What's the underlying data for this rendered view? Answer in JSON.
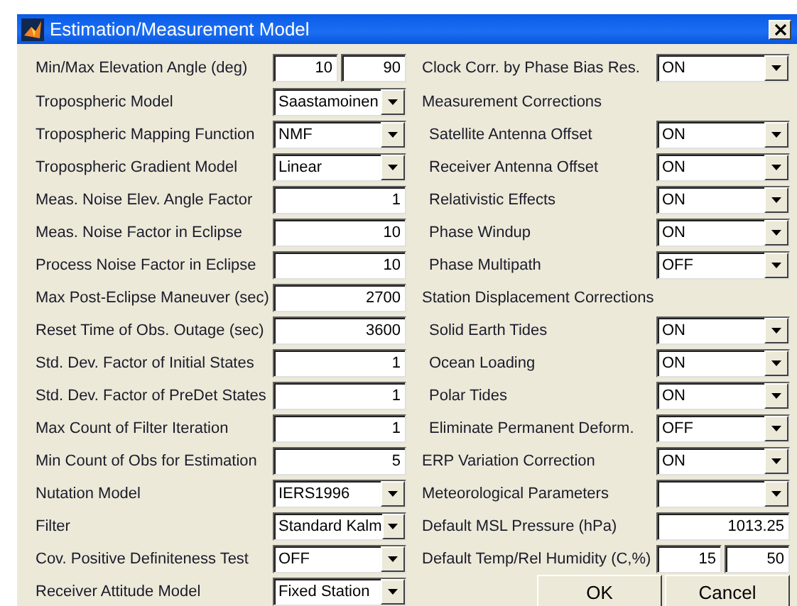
{
  "window": {
    "title": "Estimation/Measurement Model"
  },
  "left_fields": [
    {
      "kind": "edit",
      "label": "Min/Max Elevation Angle (deg)",
      "values": [
        "10",
        "90"
      ]
    },
    {
      "kind": "select",
      "label": "Tropospheric Model",
      "value": "Saastamoinen"
    },
    {
      "kind": "select",
      "label": "Tropospheric Mapping Function",
      "value": "NMF"
    },
    {
      "kind": "select",
      "label": "Tropospheric Gradient Model",
      "value": "Linear"
    },
    {
      "kind": "edit",
      "label": "Meas. Noise Elev. Angle Factor",
      "values": [
        "1"
      ]
    },
    {
      "kind": "edit",
      "label": "Meas. Noise Factor in Eclipse",
      "values": [
        "10"
      ]
    },
    {
      "kind": "edit",
      "label": "Process Noise Factor in Eclipse",
      "values": [
        "10"
      ]
    },
    {
      "kind": "edit",
      "label": "Max Post-Eclipse Maneuver (sec)",
      "values": [
        "2700"
      ]
    },
    {
      "kind": "edit",
      "label": "Reset Time of Obs. Outage (sec)",
      "values": [
        "3600"
      ]
    },
    {
      "kind": "edit",
      "label": "Std. Dev. Factor of Initial States",
      "values": [
        "1"
      ]
    },
    {
      "kind": "edit",
      "label": "Std. Dev. Factor of PreDet States",
      "values": [
        "1"
      ]
    },
    {
      "kind": "edit",
      "label": "Max Count of Filter Iteration",
      "values": [
        "1"
      ]
    },
    {
      "kind": "edit",
      "label": "Min Count of Obs for Estimation",
      "values": [
        "5"
      ]
    },
    {
      "kind": "select",
      "label": "Nutation Model",
      "value": "IERS1996"
    },
    {
      "kind": "select",
      "label": "Filter",
      "value": "Standard Kalm"
    },
    {
      "kind": "select",
      "label": "Cov. Positive Definiteness Test",
      "value": "OFF"
    },
    {
      "kind": "select",
      "label": "Receiver Attitude Model",
      "value": "Fixed Station"
    }
  ],
  "right_fields": [
    {
      "kind": "select",
      "label": "Clock Corr. by Phase Bias Res.",
      "value": "ON"
    },
    {
      "kind": "header",
      "label": "Measurement Corrections",
      "children": [
        {
          "kind": "select",
          "label": "Satellite Antenna Offset",
          "value": "ON"
        },
        {
          "kind": "select",
          "label": "Receiver Antenna Offset",
          "value": "ON"
        },
        {
          "kind": "select",
          "label": "Relativistic Effects",
          "value": "ON"
        },
        {
          "kind": "select",
          "label": "Phase Windup",
          "value": "ON"
        },
        {
          "kind": "select",
          "label": "Phase Multipath",
          "value": "OFF"
        }
      ]
    },
    {
      "kind": "header",
      "label": "Station Displacement Corrections",
      "children": [
        {
          "kind": "select",
          "label": "Solid Earth Tides",
          "value": "ON"
        },
        {
          "kind": "select",
          "label": "Ocean Loading",
          "value": "ON"
        },
        {
          "kind": "select",
          "label": "Polar Tides",
          "value": "ON"
        },
        {
          "kind": "select",
          "label": "Eliminate Permanent Deform.",
          "value": "OFF"
        }
      ]
    },
    {
      "kind": "select",
      "label": "ERP Variation Correction",
      "value": "ON"
    },
    {
      "kind": "select",
      "label": "Meteorological Parameters"
    },
    {
      "kind": "edit",
      "label": "Default MSL Pressure (hPa)",
      "values": [
        "1013.25"
      ]
    },
    {
      "kind": "edit",
      "label": "Default Temp/Rel Humidity (C,%)",
      "values": [
        "15",
        "50"
      ]
    }
  ],
  "buttons": [
    "OK",
    "Cancel"
  ]
}
